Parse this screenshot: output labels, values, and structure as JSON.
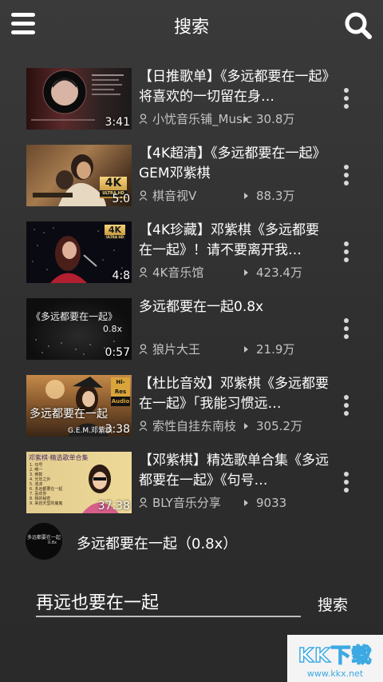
{
  "header": {
    "title": "搜索",
    "menu_icon": "hamburger-menu-icon",
    "search_icon": "search-icon"
  },
  "results": [
    {
      "title": "【日推歌单】《多远都要在一起》将喜欢的一切留在身…",
      "channel": "小忧音乐铺_Music",
      "views": "30.8万",
      "duration": "3:41"
    },
    {
      "title": "【4K超清】《多远都要在一起》GEM邓紫棋",
      "channel": "棋音视V",
      "views": "88.3万",
      "duration": "5:0"
    },
    {
      "title": "【4K珍藏】邓紫棋《多远都要在一起》！请不要离开我…",
      "channel": "4K音乐馆",
      "views": "423.4万",
      "duration": "4:8"
    },
    {
      "title": "多远都要在一起0.8x",
      "channel": "狼片大王",
      "views": "21.9万",
      "duration": "0:57"
    },
    {
      "title": "【杜比音效】邓紫棋《多远都要在一起》「我能习惯远…",
      "channel": "索性自挂东南枝",
      "views": "305.2万",
      "duration": "3:38"
    },
    {
      "title": "【邓紫棋】精选歌单合集《多远都要在一起》《句号…",
      "channel": "BLY音乐分享",
      "views": "9033",
      "duration": "37:38"
    }
  ],
  "thumb_overlays": {
    "hd_badge": "4K",
    "hd_badge_sub": "ULTRA HD",
    "clip_caption": "《多远都要在一起》",
    "clip_speed": "0.8x",
    "hires_badge": "Hi-Res",
    "hires_badge_sub": "Audio",
    "singer_line": "G.E.M.邓紫棋",
    "overlay_song": "多远都要在一起",
    "playlist_header": "邓紫棋·精选歌单合集",
    "playlist_tracks": [
      "句号",
      "唯一",
      "倒数",
      "光年之外",
      "泡沫",
      "多远都要在一起",
      "喜欢你",
      "我的秘密",
      "来自天堂的魔鬼"
    ]
  },
  "player": {
    "title": "多远都要在一起（0.8x）",
    "thumb_caption": "多远都要在一起",
    "thumb_speed": "0.8x"
  },
  "search": {
    "value": "再远也要在一起",
    "submit_label": "搜索"
  },
  "watermark": {
    "logo_text": "KK下载",
    "url": "www.kkx.net"
  },
  "colors": {
    "background": "#333333",
    "text": "#ffffff",
    "meta_text": "#c4c4c4",
    "watermark_blue": "#3ca9e2"
  }
}
